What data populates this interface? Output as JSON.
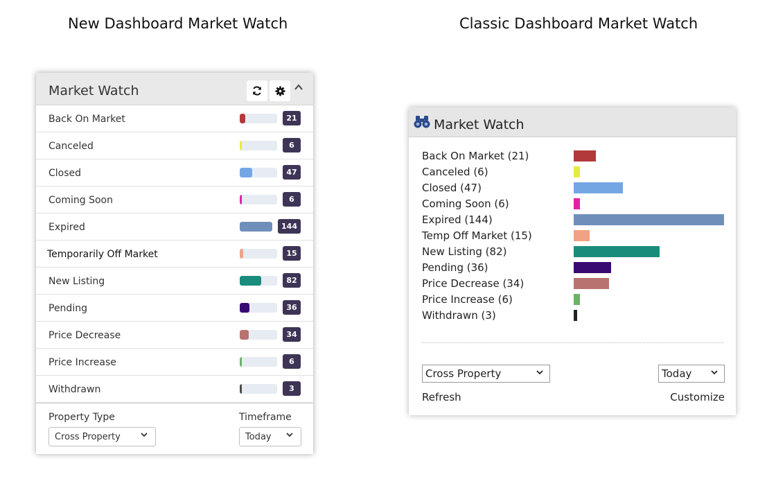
{
  "captions": {
    "new": "New Dashboard Market Watch",
    "classic": "Classic Dashboard Market Watch"
  },
  "colors": {
    "badge": "#3e3456",
    "track": "#e6ecf1"
  },
  "new_dashboard": {
    "title": "Market Watch",
    "icons": [
      "refresh-icon",
      "gear-icon",
      "chevron-up-icon"
    ],
    "rows": [
      {
        "label": "Back On Market",
        "count": "21",
        "color": "#b23a3a",
        "fraction": 0.15
      },
      {
        "label": "Canceled",
        "count": "6",
        "color": "#e5ec3f",
        "fraction": 0.04
      },
      {
        "label": "Closed",
        "count": "47",
        "color": "#74a6e4",
        "fraction": 0.33
      },
      {
        "label": "Coming Soon",
        "count": "6",
        "color": "#e61fa8",
        "fraction": 0.04
      },
      {
        "label": "Expired",
        "count": "144",
        "color": "#6f8fba",
        "fraction": 1.0
      },
      {
        "label": "Temporarily Off Market",
        "count": "15",
        "color": "#f0a283",
        "fraction": 0.1
      },
      {
        "label": "New Listing",
        "count": "82",
        "color": "#1a8c7b",
        "fraction": 0.57
      },
      {
        "label": "Pending",
        "count": "36",
        "color": "#3a0a73",
        "fraction": 0.25
      },
      {
        "label": "Price Decrease",
        "count": "34",
        "color": "#b87370",
        "fraction": 0.24
      },
      {
        "label": "Price Increase",
        "count": "6",
        "color": "#6ab36a",
        "fraction": 0.04
      },
      {
        "label": "Withdrawn",
        "count": "3",
        "color": "#4a4a4a",
        "fraction": 0.02
      }
    ],
    "footer": {
      "property_type_label": "Property Type",
      "property_type_value": "Cross Property",
      "timeframe_label": "Timeframe",
      "timeframe_value": "Today"
    }
  },
  "classic_dashboard": {
    "title": "Market Watch",
    "rows": [
      {
        "label": "Back On Market (21)",
        "value": 21,
        "color": "#b23a3a"
      },
      {
        "label": "Canceled (6)",
        "value": 6,
        "color": "#e5ec3f"
      },
      {
        "label": "Closed (47)",
        "value": 47,
        "color": "#74a6e4"
      },
      {
        "label": "Coming Soon (6)",
        "value": 6,
        "color": "#e61fa8"
      },
      {
        "label": "Expired (144)",
        "value": 144,
        "color": "#6f8fba"
      },
      {
        "label": "Temp Off Market (15)",
        "value": 15,
        "color": "#f0a283"
      },
      {
        "label": "New Listing (82)",
        "value": 82,
        "color": "#1a8c7b"
      },
      {
        "label": "Pending (36)",
        "value": 36,
        "color": "#3a0a73"
      },
      {
        "label": "Price Decrease (34)",
        "value": 34,
        "color": "#b87370"
      },
      {
        "label": "Price Increase (6)",
        "value": 6,
        "color": "#6ab36a"
      },
      {
        "label": "Withdrawn (3)",
        "value": 3,
        "color": "#222222"
      }
    ],
    "property_select_value": "Cross Property",
    "timeframe_select_value": "Today",
    "refresh_label": "Refresh",
    "customize_label": "Customize"
  }
}
